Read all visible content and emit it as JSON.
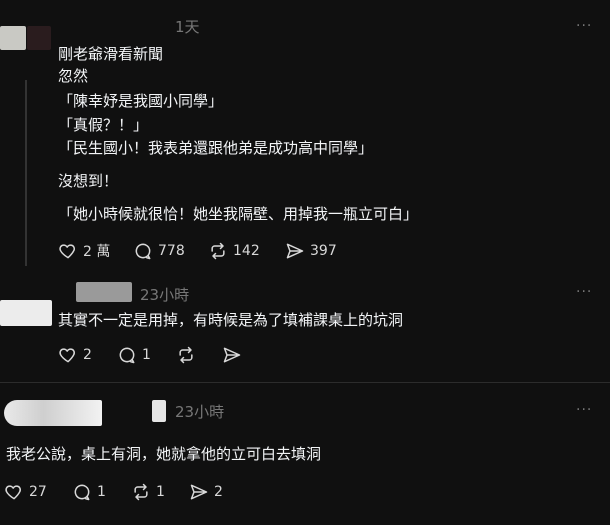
{
  "post1": {
    "time": "1天",
    "more": "···",
    "lines": [
      "剛老爺滑看新聞",
      "忽然",
      "「陳幸妤是我國小同學」",
      "「真假？！」",
      "「民生國小！我表弟還跟他弟是成功高中同學」",
      "沒想到！",
      "「她小時候就很恰！她坐我隔壁、用掉我一瓶立可白」"
    ],
    "likes": "2 萬",
    "comments": "778",
    "reposts": "142",
    "shares": "397"
  },
  "post2": {
    "time": "23小時",
    "more": "···",
    "text": "其實不一定是用掉，有時候是為了填補課桌上的坑洞",
    "likes": "2",
    "comments": "1"
  },
  "post3": {
    "time": "23小時",
    "more": "···",
    "text": "我老公說，桌上有洞，她就拿他的立可白去填洞",
    "likes": "27",
    "comments": "1",
    "reposts": "1",
    "shares": "2"
  },
  "icons": [
    "heart-icon",
    "comment-icon",
    "repost-icon",
    "share-icon",
    "more-icon"
  ]
}
